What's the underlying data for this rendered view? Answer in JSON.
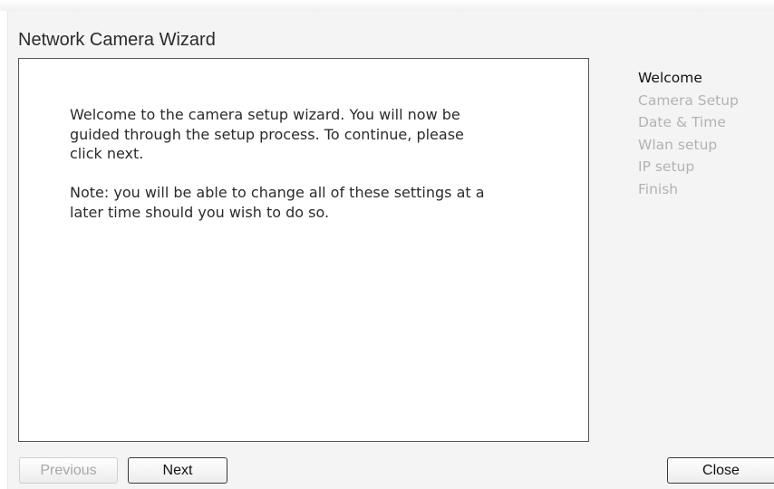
{
  "wizard": {
    "title": "Network Camera Wizard",
    "message": {
      "intro": "Welcome to the camera setup wizard. You will now be guided through the setup process. To continue, please click next.",
      "note": "Note: you will be able to change all of these settings at a later time should you wish to do so."
    },
    "steps": [
      {
        "label": "Welcome",
        "active": true
      },
      {
        "label": "Camera Setup",
        "active": false
      },
      {
        "label": "Date & Time",
        "active": false
      },
      {
        "label": "Wlan setup",
        "active": false
      },
      {
        "label": "IP setup",
        "active": false
      },
      {
        "label": "Finish",
        "active": false
      }
    ],
    "buttons": {
      "previous_label": "Previous",
      "previous_enabled": false,
      "next_label": "Next",
      "close_label": "Close"
    },
    "colors": {
      "active_step": "#111111",
      "inactive_step": "#b3b3b3",
      "panel_background": "#f4f4f4"
    }
  }
}
